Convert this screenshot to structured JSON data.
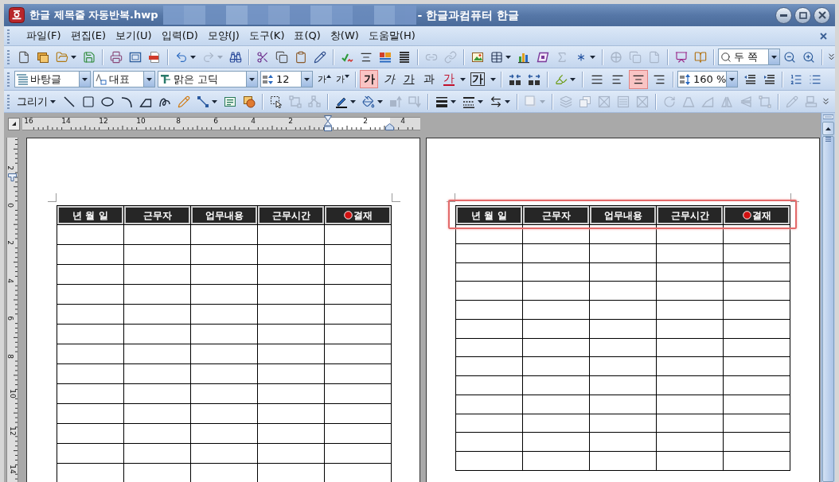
{
  "window": {
    "title": "한글 제목줄 자동반복.hwp",
    "app_name": "- 한글과컴퓨터 한글"
  },
  "menu_bar": {
    "items": [
      "파일(F)",
      "편집(E)",
      "보기(U)",
      "입력(D)",
      "모양(J)",
      "도구(K)",
      "표(Q)",
      "창(W)",
      "도움말(H)"
    ]
  },
  "standard_toolbar": {
    "zoom": "두 쪽"
  },
  "format_toolbar": {
    "style": "바탕글",
    "char_style": "대표",
    "font": "맑은 고딕",
    "size": "12",
    "size_buttons": [
      {
        "glyph": "가",
        "kind": "grow"
      },
      {
        "glyph": "가",
        "kind": "shrink"
      }
    ],
    "char_buttons": [
      {
        "glyph": "가",
        "kind": "bold",
        "selected": true
      },
      {
        "glyph": "가",
        "kind": "italic",
        "selected": false
      },
      {
        "glyph": "가",
        "kind": "underline",
        "selected": false
      },
      {
        "glyph": "과",
        "kind": "plain",
        "selected": false
      },
      {
        "glyph": "가",
        "kind": "color",
        "selected": false
      },
      {
        "glyph": "가",
        "kind": "boxed",
        "selected": false
      }
    ],
    "align_buttons": [
      {
        "kind": "justify",
        "selected": false
      },
      {
        "kind": "left",
        "selected": false
      },
      {
        "kind": "center",
        "selected": true
      },
      {
        "kind": "right",
        "selected": false
      }
    ],
    "line_spacing": "160 %"
  },
  "drawing_toolbar": {
    "draw_menu": "그리기"
  },
  "rulers": {
    "horizontal": [
      "16",
      "14",
      "12",
      "10",
      "8",
      "6",
      "4",
      "2",
      "2",
      "4"
    ],
    "vertical": [
      "2",
      "0",
      "2",
      "4",
      "6",
      "8",
      "10",
      "12",
      "14"
    ]
  },
  "pages": [
    {
      "highlighted": false,
      "columns": [
        {
          "label": "년 월 일",
          "marked": false
        },
        {
          "label": "근무자",
          "marked": false
        },
        {
          "label": "업무내용",
          "marked": false
        },
        {
          "label": "근무시간",
          "marked": false
        },
        {
          "label": "결재",
          "marked": true
        }
      ]
    },
    {
      "highlighted": true,
      "columns": [
        {
          "label": "년 월 일",
          "marked": false
        },
        {
          "label": "근무자",
          "marked": false
        },
        {
          "label": "업무내용",
          "marked": false
        },
        {
          "label": "근무시간",
          "marked": false
        },
        {
          "label": "결재",
          "marked": true
        }
      ]
    }
  ]
}
